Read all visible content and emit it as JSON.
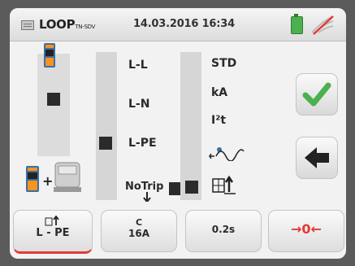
{
  "header": {
    "title": "LOOP",
    "title_sub": "TN-SDV",
    "datetime": "14.03.2016 16:34"
  },
  "connection": {
    "labels": [
      "L-L",
      "L-N",
      "L-PE",
      "NoTrip"
    ],
    "selected": "L-PE"
  },
  "measure": {
    "labels": [
      "STD",
      "kA",
      "I²t"
    ],
    "selected_icon": "ground-loop-icon"
  },
  "tabs": [
    {
      "line1": "",
      "line2": "L - PE",
      "active": true
    },
    {
      "line1": "C",
      "line2": "16A",
      "active": false
    },
    {
      "line1": "",
      "line2": "0.2s",
      "active": false
    },
    {
      "line1": "",
      "line2": "→0←",
      "active": false
    }
  ],
  "colors": {
    "accent": "#e53935",
    "ok": "#4caf50",
    "battery": "#4caf50"
  }
}
